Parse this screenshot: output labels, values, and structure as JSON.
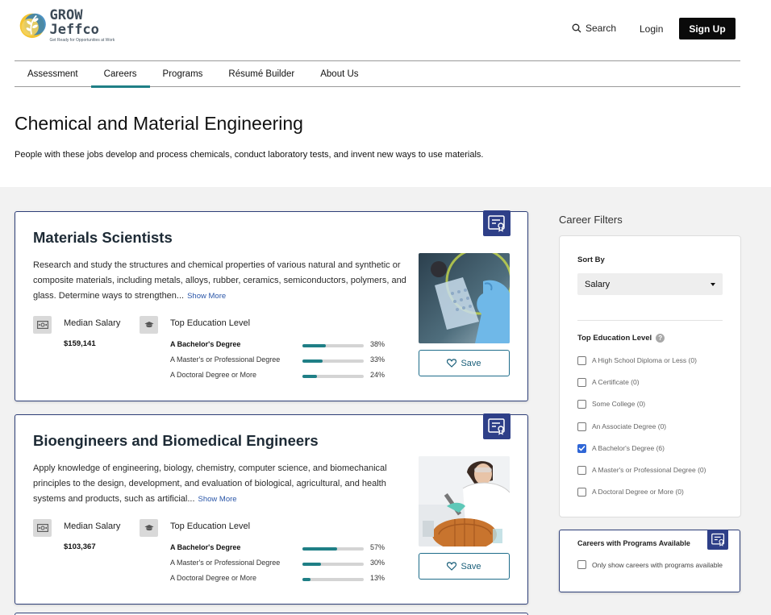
{
  "header": {
    "logo_title": "GROW Jeffco",
    "logo_tagline": "Get Ready for Opportunities at Work",
    "search_label": "Search",
    "login_label": "Login",
    "signup_label": "Sign Up"
  },
  "nav": {
    "items": [
      {
        "label": "Assessment",
        "active": false
      },
      {
        "label": "Careers",
        "active": true
      },
      {
        "label": "Programs",
        "active": false
      },
      {
        "label": "Résumé Builder",
        "active": false
      },
      {
        "label": "About Us",
        "active": false
      }
    ]
  },
  "page": {
    "title": "Chemical and Material Engineering",
    "description": "People with these jobs develop and process chemicals, conduct laboratory tests, and invent new ways to use materials."
  },
  "careers": [
    {
      "title": "Materials Scientists",
      "description": "Research and study the structures and chemical properties of various natural and synthetic or composite materials, including metals, alloys, rubber, ceramics, semiconductors, polymers, and glass. Determine ways to strengthen...",
      "show_more": "Show More",
      "salary_label": "Median Salary",
      "salary": "$159,141",
      "education_label": "Top Education Level",
      "education": [
        {
          "name": "A Bachelor's Degree",
          "pct": "38%",
          "value": 38,
          "bold": true
        },
        {
          "name": "A Master's or Professional Degree",
          "pct": "33%",
          "value": 33,
          "bold": false
        },
        {
          "name": "A Doctoral Degree or More",
          "pct": "24%",
          "value": 24,
          "bold": false
        }
      ],
      "save_label": "Save"
    },
    {
      "title": "Bioengineers and Biomedical Engineers",
      "description": "Apply knowledge of engineering, biology, chemistry, computer science, and biomechanical principles to the design, development, and evaluation of biological, agricultural, and health systems and products, such as artificial...",
      "show_more": "Show More",
      "salary_label": "Median Salary",
      "salary": "$103,367",
      "education_label": "Top Education Level",
      "education": [
        {
          "name": "A Bachelor's Degree",
          "pct": "57%",
          "value": 57,
          "bold": true
        },
        {
          "name": "A Master's or Professional Degree",
          "pct": "30%",
          "value": 30,
          "bold": false
        },
        {
          "name": "A Doctoral Degree or More",
          "pct": "13%",
          "value": 13,
          "bold": false
        }
      ],
      "save_label": "Save"
    }
  ],
  "filters": {
    "title": "Career Filters",
    "sort_label": "Sort By",
    "sort_value": "Salary",
    "education_label": "Top Education Level",
    "help_glyph": "?",
    "education_options": [
      {
        "label": "A High School Diploma or Less (0)",
        "checked": false
      },
      {
        "label": "A Certificate (0)",
        "checked": false
      },
      {
        "label": "Some College (0)",
        "checked": false
      },
      {
        "label": "An Associate Degree (0)",
        "checked": false
      },
      {
        "label": "A Bachelor's Degree (6)",
        "checked": true
      },
      {
        "label": "A Master's or Professional Degree (0)",
        "checked": false
      },
      {
        "label": "A Doctoral Degree or More (0)",
        "checked": false
      }
    ]
  },
  "programs_filter": {
    "title": "Careers with Programs Available",
    "option_label": "Only show careers with programs available",
    "checked": false
  },
  "colors": {
    "accent_teal": "#1f7f86",
    "badge_navy": "#2e3f88",
    "link_blue": "#2a56a8",
    "checkbox_blue": "#2f66d6"
  },
  "icons": {
    "search": "search-icon",
    "badge": "certificate-icon",
    "salary": "money-icon",
    "education": "graduation-cap-icon",
    "save": "heart-icon"
  }
}
